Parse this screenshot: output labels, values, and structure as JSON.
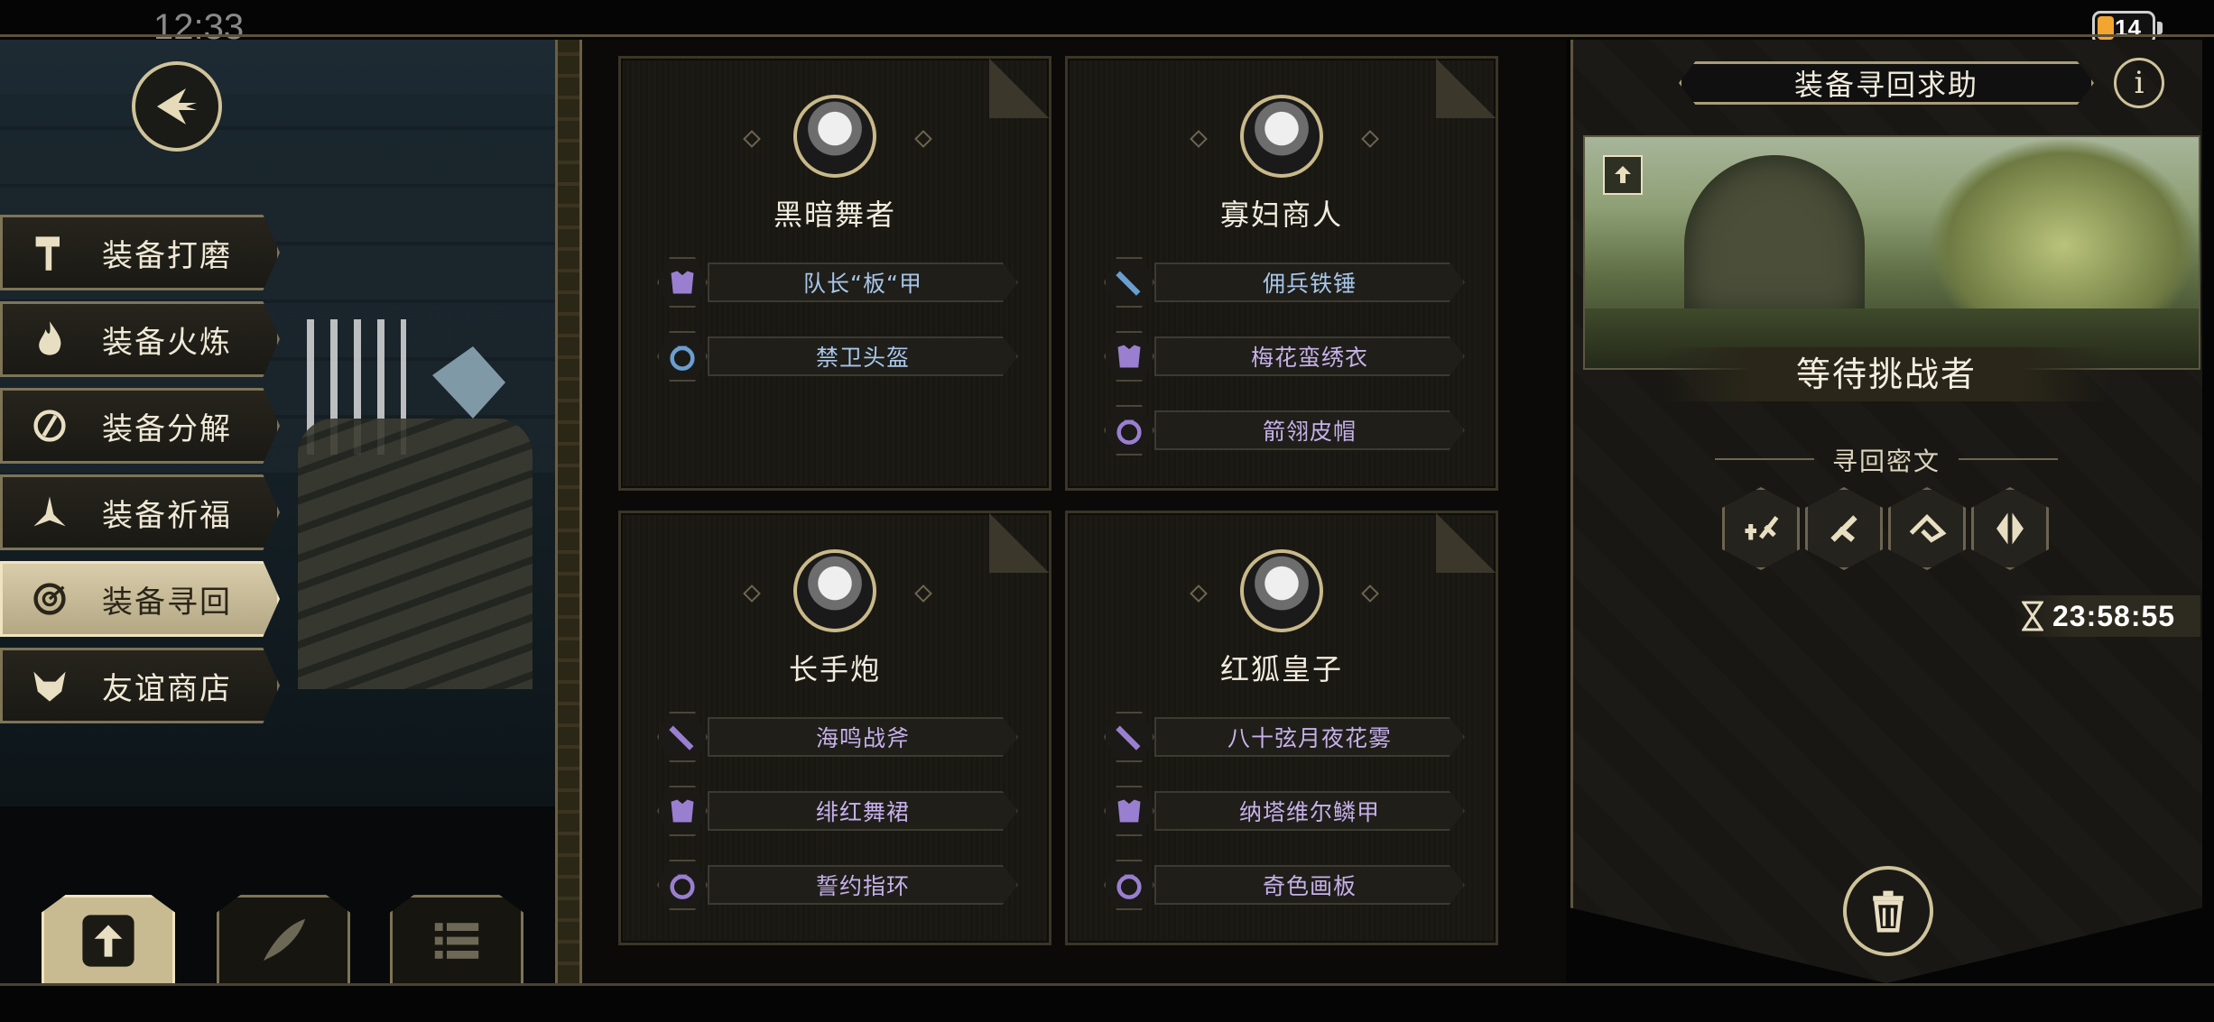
{
  "status": {
    "time": "12:33",
    "battery": "14"
  },
  "menu": {
    "items": [
      {
        "label": "装备打磨",
        "icon": "hammer-icon"
      },
      {
        "label": "装备火炼",
        "icon": "flame-icon"
      },
      {
        "label": "装备分解",
        "icon": "disassemble-icon"
      },
      {
        "label": "装备祈福",
        "icon": "blessing-icon"
      },
      {
        "label": "装备寻回",
        "icon": "retrieve-icon",
        "active": true
      },
      {
        "label": "友谊商店",
        "icon": "fox-icon"
      }
    ]
  },
  "bottom_tabs": [
    {
      "icon": "upload-icon",
      "active": true
    },
    {
      "icon": "feather-icon"
    },
    {
      "icon": "list-icon"
    }
  ],
  "cards": [
    {
      "name": "黑暗舞者",
      "items": [
        {
          "label": "队长“板“甲",
          "icon": "armor-icon",
          "color": "blue"
        },
        {
          "label": "禁卫头盔",
          "icon": "ring-icon",
          "color": "blue"
        }
      ]
    },
    {
      "name": "寡妇商人",
      "items": [
        {
          "label": "佣兵铁锤",
          "icon": "sword-icon",
          "color": "blue"
        },
        {
          "label": "梅花蛮绣衣",
          "icon": "armor-icon",
          "color": "purple"
        },
        {
          "label": "箭翎皮帽",
          "icon": "ring-icon",
          "color": "purple"
        }
      ]
    },
    {
      "name": "长手炮",
      "items": [
        {
          "label": "海鸣战斧",
          "icon": "sword-icon",
          "color": "purple"
        },
        {
          "label": "绯红舞裙",
          "icon": "armor-icon",
          "color": "purple"
        },
        {
          "label": "誓约指环",
          "icon": "ring-icon",
          "color": "purple"
        }
      ]
    },
    {
      "name": "红狐皇子",
      "items": [
        {
          "label": "八十弦月夜花雾",
          "icon": "sword-icon",
          "color": "purple"
        },
        {
          "label": "纳塔维尔鳞甲",
          "icon": "armor-icon",
          "color": "purple"
        },
        {
          "label": "奇色画板",
          "icon": "ring-icon",
          "color": "purple"
        }
      ]
    }
  ],
  "panel": {
    "title": "装备寻回求助",
    "info_icon": "info-icon",
    "status": "等待挑战者",
    "cipher_title": "寻回密文",
    "runes": [
      "rune-1-icon",
      "rune-2-icon",
      "rune-3-icon",
      "rune-4-icon"
    ],
    "timer": "23:58:55"
  },
  "colors": {
    "blue": "#a7c6ea",
    "purple": "#c6b1ea",
    "gold": "#cfc39a"
  }
}
